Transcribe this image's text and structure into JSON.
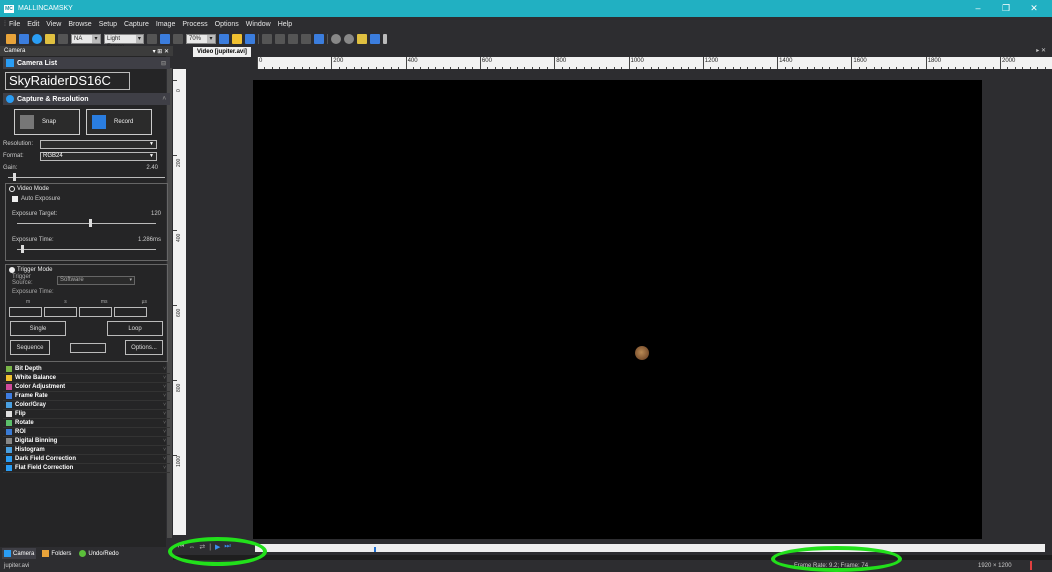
{
  "app": {
    "title": "MALLINCAMSKY",
    "icon_text": "MC"
  },
  "window_controls": [
    "–",
    "❐",
    "✕"
  ],
  "menu": [
    "File",
    "Edit",
    "View",
    "Browse",
    "Setup",
    "Capture",
    "Image",
    "Process",
    "Options",
    "Window",
    "Help"
  ],
  "toolbar": {
    "na_combo": "NA",
    "frame_combo": "Light Frame",
    "zoom_combo": "70%"
  },
  "left_panel": {
    "header": "Camera",
    "header_controls": "▾ ⊞ ✕",
    "camera_list_title": "Camera List",
    "camera_name": "SkyRaiderDS16C",
    "capture_title": "Capture & Resolution",
    "snap_label": "Snap",
    "record_label": "Record",
    "resolution_label": "Resolution:",
    "resolution_value": "",
    "format_label": "Format:",
    "format_value": "RGB24",
    "gain_label": "Gain:",
    "gain_value": "2.40",
    "gain_level": 0.03,
    "video_mode_label": "Video Mode",
    "auto_exposure_label": "Auto Exposure",
    "exposure_target_label": "Exposure Target:",
    "exposure_target_value": "120",
    "exposure_target_level": 0.52,
    "exposure_time_label": "Exposure Time:",
    "exposure_time_value": "1.286ms",
    "exposure_time_level": 0.03,
    "trigger_mode_label": "Trigger Mode",
    "trigger_source_label": "Trigger Source:",
    "trigger_source_value": "Software",
    "trigger_exposure_time_label": "Exposure Time:",
    "time_units": [
      "m",
      "s",
      "ms",
      "µs"
    ],
    "single_label": "Single",
    "loop_label": "Loop",
    "sequence_label": "Sequence",
    "options_label": "Options...",
    "features": [
      {
        "label": "Bit Depth",
        "color": "#7ab648"
      },
      {
        "label": "White Balance",
        "color": "#f2c230"
      },
      {
        "label": "Color Adjustment",
        "color": "#d04b9a"
      },
      {
        "label": "Frame Rate",
        "color": "#3e7de0"
      },
      {
        "label": "Color/Gray",
        "color": "#4aa0e0"
      },
      {
        "label": "Flip",
        "color": "#e0e0e0"
      },
      {
        "label": "Rotate",
        "color": "#5bbf6a"
      },
      {
        "label": "ROI",
        "color": "#3a7bd5"
      },
      {
        "label": "Digital Binning",
        "color": "#888888"
      },
      {
        "label": "Histogram",
        "color": "#4aa0e0"
      },
      {
        "label": "Dark Field Correction",
        "color": "#2a9df4"
      },
      {
        "label": "Flat Field Correction",
        "color": "#2a9df4"
      }
    ]
  },
  "bottom_tabs": [
    "Camera",
    "Folders",
    "Undo/Redo"
  ],
  "document": {
    "tab_label": "Video [jupiter.avi]",
    "tab_controls": "▸ ✕",
    "hruler_labels": [
      "0",
      "200",
      "400",
      "600",
      "800",
      "1000",
      "1200",
      "1400",
      "1600",
      "1800",
      "2000"
    ],
    "vruler_labels": [
      "0",
      "200",
      "400",
      "600",
      "800",
      "1000"
    ]
  },
  "playback": {
    "controls": [
      "⏮",
      "⇔",
      "⇄",
      "|",
      "▶",
      "⏭"
    ],
    "position_fraction": 0.15
  },
  "status": {
    "file": "jupiter.avi",
    "frame_info": "Frame Rate: 9.2; Frame: 74",
    "dimensions": "1920 × 1200"
  },
  "colors": {
    "titlebar": "#21b0c2",
    "highlight": "#22e01b"
  }
}
